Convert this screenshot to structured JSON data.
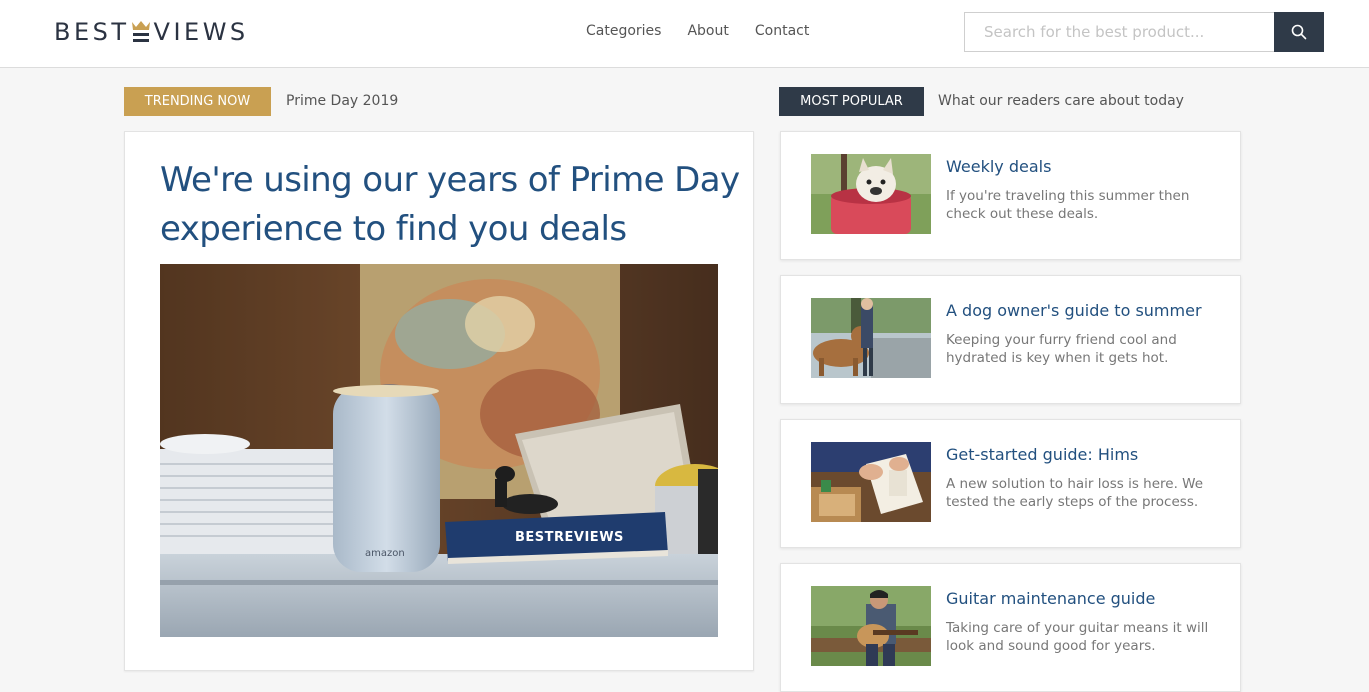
{
  "header": {
    "logo_text_left": "BEST",
    "logo_text_right": "VIEWS",
    "nav": [
      "Categories",
      "About",
      "Contact"
    ],
    "search_placeholder": "Search for the best product...",
    "colors": {
      "navy": "#2f3a48",
      "gold": "#c9a052",
      "link_blue": "#22507f"
    }
  },
  "trending": {
    "badge": "TRENDING NOW",
    "label": "Prime Day 2019",
    "feature_title": "We're using our years of Prime Day experience to find you deals",
    "image_book_text": "BESTREVIEWS",
    "image_speaker_text": "amazon"
  },
  "popular": {
    "badge": "MOST POPULAR",
    "label": "What our readers care about today",
    "items": [
      {
        "title": "Weekly deals",
        "desc": "If you're traveling this summer then check out these deals."
      },
      {
        "title": "A dog owner's guide to summer",
        "desc": "Keeping your furry friend cool and hydrated is key when it gets hot."
      },
      {
        "title": "Get-started guide: Hims",
        "desc": "A new solution to hair loss is here. We tested the early steps of the process."
      },
      {
        "title": "Guitar maintenance guide",
        "desc": "Taking care of your guitar means it will look and sound good for years."
      }
    ]
  }
}
